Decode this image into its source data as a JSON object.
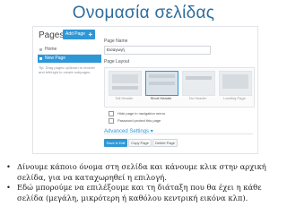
{
  "slide": {
    "title": "Ονομασία σελίδας",
    "bullets": [
      "Δίνουμε κάποιο όνομα στη σελίδα και κάνουμε κλικ στην αρχική σελίδα, για να καταχωρηθεί η επιλογή.",
      "Εδώ μπορούμε να επιλέξουμε και τη διάταξη που θα έχει η κάθε σελίδα (μεγάλη, μικρότερη ή καθόλου κεντρική εικόνα κλπ)."
    ]
  },
  "screenshot": {
    "pages_heading": "Pages",
    "add_page_label": "Add Page",
    "add_page_icon": "plus-icon",
    "tree": [
      {
        "label": "Home",
        "active": false
      },
      {
        "label": "New Page",
        "active": true
      }
    ],
    "tip": "Tip: Drag pages up/down to reorder and left/right to create subpages.",
    "page_name_label": "Page Name",
    "page_name_value": "Εισαγωγή",
    "page_layout_label": "Page Layout",
    "layouts": [
      {
        "label": "Tall Header",
        "selected": false
      },
      {
        "label": "Short Header",
        "selected": true
      },
      {
        "label": "No Header",
        "selected": false
      },
      {
        "label": "Landing Page",
        "selected": false
      }
    ],
    "options": [
      {
        "label": "Hide page in navigation menu",
        "icon": "eye-off-icon"
      },
      {
        "label": "Password protect this page",
        "icon": "lock-icon"
      }
    ],
    "advanced_label": "Advanced Settings ▾",
    "buttons": {
      "save": "Save & Edit",
      "copy": "Copy Page",
      "delete": "Delete Page"
    },
    "accent_color": "#2e97d6"
  }
}
